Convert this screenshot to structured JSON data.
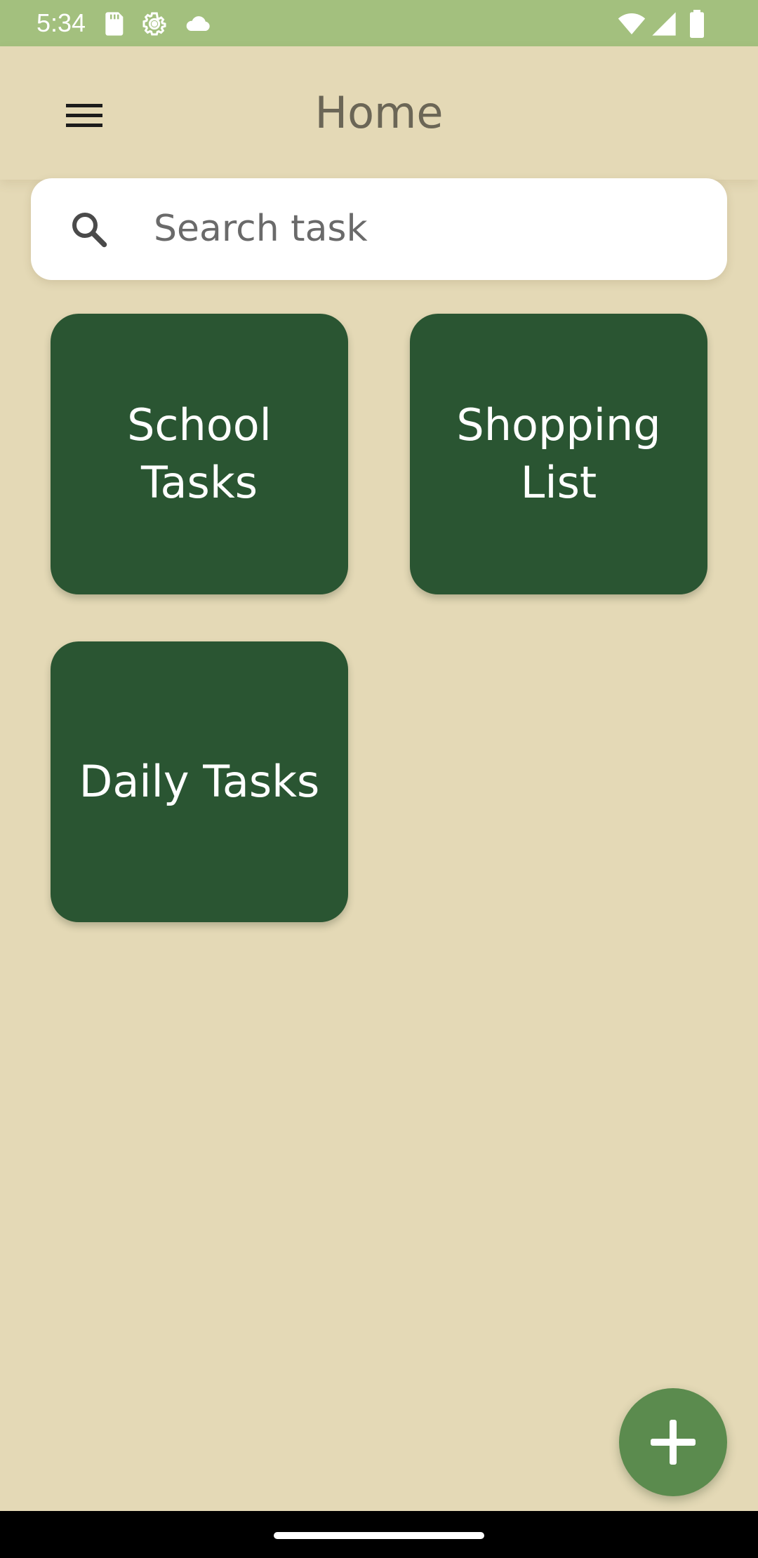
{
  "status_bar": {
    "time": "5:34",
    "left_icons": [
      "sd-card-icon",
      "settings-gear-icon",
      "cloud-icon"
    ],
    "right_icons": [
      "wifi-icon",
      "cellular-signal-icon",
      "battery-icon"
    ],
    "background_color": "#a3c07e"
  },
  "app_bar": {
    "title": "Home",
    "menu_icon": "hamburger-menu-icon"
  },
  "search": {
    "placeholder": "Search task",
    "value": "",
    "icon": "search-icon"
  },
  "lists": [
    {
      "label": "School Tasks"
    },
    {
      "label": "Shopping List"
    },
    {
      "label": "Daily Tasks"
    }
  ],
  "fab": {
    "icon": "plus-icon",
    "color": "#5b8b4e"
  },
  "colors": {
    "background": "#e4d9b6",
    "card": "#2a5532",
    "title_text": "#6b6656"
  }
}
